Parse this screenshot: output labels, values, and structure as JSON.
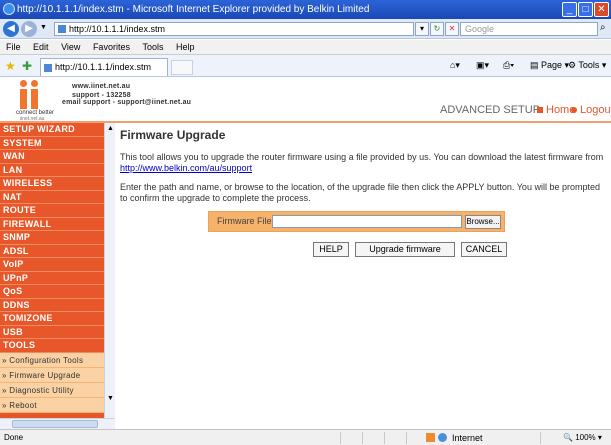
{
  "window": {
    "title": "http://10.1.1.1/index.stm - Microsoft Internet Explorer provided by Belkin Limited",
    "minimize": "_",
    "maximize": "□",
    "close": "✕"
  },
  "toolbar": {
    "back": "◀",
    "forward": "▶",
    "url": "http://10.1.1.1/index.stm",
    "refresh": "↻",
    "stop": "✕",
    "search_placeholder": "Google",
    "search_icon": "search-icon"
  },
  "menu": [
    "File",
    "Edit",
    "View",
    "Favorites",
    "Tools",
    "Help"
  ],
  "favorites_bar": {
    "tab_title": "http://10.1.1.1/index.stm",
    "page_label": "Page",
    "tools_label": "Tools"
  },
  "header": {
    "logo_tagline": "connect better",
    "logo_site": "iinet.net.au",
    "line1": "www.iinet.net.au",
    "line2": "support - 132258",
    "line3": "email support - support@iinet.net.au",
    "advanced": "ADVANCED SETUP",
    "home": "Home",
    "logout": "Logout",
    "accent": "#e8572a"
  },
  "sidebar": {
    "items": [
      "SETUP WIZARD",
      "SYSTEM",
      "WAN",
      "LAN",
      "WIRELESS",
      "NAT",
      "ROUTE",
      "FIREWALL",
      "SNMP",
      "ADSL",
      "VoIP",
      "UPnP",
      "QoS",
      "DDNS",
      "TOMIZONE",
      "USB",
      "TOOLS"
    ],
    "subitems": [
      "» Configuration Tools",
      "» Firmware Upgrade",
      "» Diagnostic Utility",
      "» Reboot"
    ]
  },
  "main": {
    "title": "Firmware Upgrade",
    "intro_text": "This tool allows you to upgrade the router firmware using a file provided by us. You can download the latest firmware from",
    "intro_link": "http://www.belkin.com/au/support",
    "instructions": "Enter the path and name, or browse to the location, of the upgrade file then click the APPLY button. You will be prompted to confirm the upgrade to complete the process.",
    "firmware_label": "Firmware File:",
    "firmware_value": "",
    "browse": "Browse...",
    "help": "HELP",
    "upgrade": "Upgrade firmware",
    "cancel": "CANCEL"
  },
  "status": {
    "text": "Done",
    "zone": "Internet",
    "zoom": "100%"
  }
}
